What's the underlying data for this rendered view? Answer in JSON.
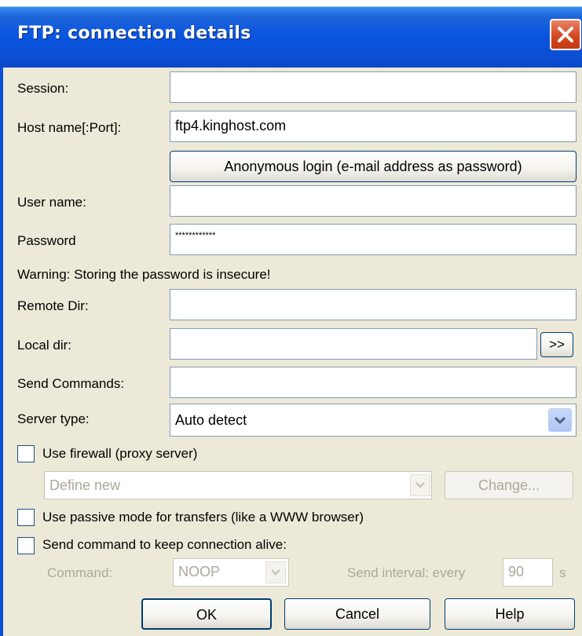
{
  "window": {
    "title": "FTP: connection details",
    "close_icon": "close-icon"
  },
  "labels": {
    "session": "Session:",
    "host": "Host name[:Port]:",
    "user": "User name:",
    "password": "Password",
    "warning": "Warning: Storing the password is insecure!",
    "remote_dir": "Remote Dir:",
    "local_dir": "Local dir:",
    "send_commands": "Send Commands:",
    "server_type": "Server type:"
  },
  "fields": {
    "session": "",
    "host": "ftp4.kinghost.com",
    "user": "",
    "password": "************",
    "remote_dir": "",
    "local_dir": "",
    "send_commands": "",
    "server_type": "Auto detect"
  },
  "buttons": {
    "anonymous": "Anonymous login (e-mail address as password)",
    "browse_local": ">>",
    "change": "Change...",
    "ok": "OK",
    "cancel": "Cancel",
    "help": "Help"
  },
  "firewall": {
    "label": "Use firewall (proxy server)",
    "checked": false,
    "define": "Define new"
  },
  "passive": {
    "label": "Use passive mode for transfers (like a WWW browser)",
    "checked": false
  },
  "keepalive": {
    "label": "Send command to keep connection alive:",
    "checked": false,
    "command_label": "Command:",
    "command_value": "NOOP",
    "interval_label": "Send interval: every",
    "interval_value": "90",
    "interval_unit": "s"
  }
}
